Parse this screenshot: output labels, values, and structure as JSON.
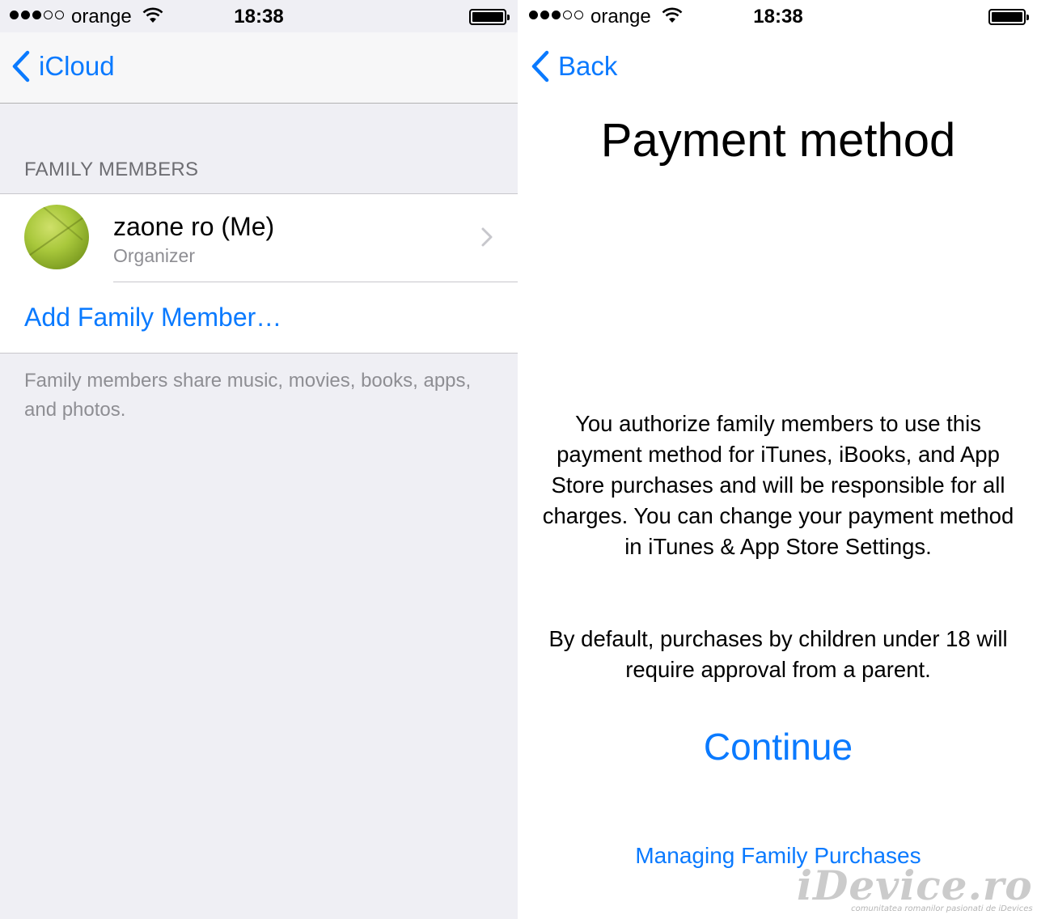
{
  "left": {
    "status": {
      "carrier": "orange",
      "time": "18:38"
    },
    "nav": {
      "back_label": "iCloud"
    },
    "section_header": "FAMILY MEMBERS",
    "member": {
      "name": "zaone ro (Me)",
      "role": "Organizer"
    },
    "add_member_label": "Add Family Member…",
    "footer_note": "Family members share music, movies, books, apps, and photos."
  },
  "right": {
    "status": {
      "carrier": "orange",
      "time": "18:38"
    },
    "nav": {
      "back_label": "Back"
    },
    "title": "Payment method",
    "paragraph1": "You authorize family members to use this payment method for iTunes, iBooks, and App Store purchases and will be responsible for all charges. You can change your payment method in iTunes & App Store Settings.",
    "paragraph2": "By default, purchases by children under 18 will require approval from a parent.",
    "continue_label": "Continue",
    "managing_label": "Managing Family Purchases"
  },
  "watermark": {
    "brand": "iDevice.ro",
    "tagline": "comunitatea romanilor pasionati de iDevices"
  },
  "colors": {
    "accent": "#0a7aff",
    "grouped_background": "#efeff4",
    "secondary_text": "#8e8e93"
  },
  "icons": [
    "signal-dots-icon",
    "wifi-icon",
    "battery-icon",
    "chevron-left-icon",
    "chevron-right-icon",
    "avatar"
  ]
}
